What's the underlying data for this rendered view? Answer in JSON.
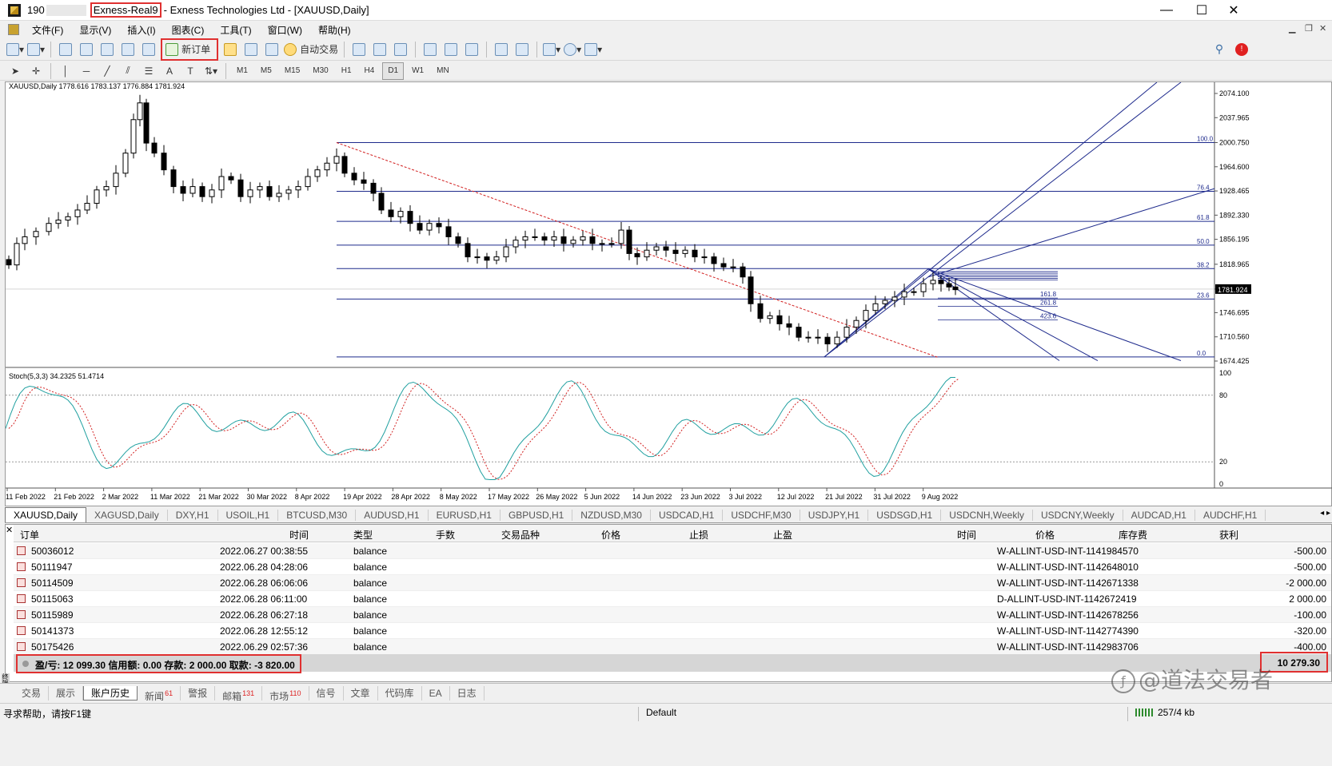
{
  "window": {
    "title_prefix": "190",
    "account": "Exness-Real9",
    "title_suffix": "- Exness Technologies Ltd - [XAUUSD,Daily]",
    "controls": [
      "—",
      "☐",
      "✕"
    ]
  },
  "menu": {
    "items": [
      "文件(F)",
      "显示(V)",
      "插入(I)",
      "图表(C)",
      "工具(T)",
      "窗口(W)",
      "帮助(H)"
    ]
  },
  "toolbar": {
    "new_order": "新订单",
    "auto_trade": "自动交易"
  },
  "timeframes": [
    "M1",
    "M5",
    "M15",
    "M30",
    "H1",
    "H4",
    "D1",
    "W1",
    "MN"
  ],
  "chart": {
    "info": "XAUUSD,Daily  1778.616 1783.137 1776.884 1781.924",
    "stoch_info": "Stoch(5,3,3) 34.2325 51.4714",
    "price_labels": [
      "2074.100",
      "2037.965",
      "2000.750",
      "1964.600",
      "1928.465",
      "1892.330",
      "1856.195",
      "1818.965",
      "1781.924",
      "1746.695",
      "1710.560",
      "1674.425"
    ],
    "current_price": "1781.924",
    "fib_levels": [
      "100.0",
      "76.4",
      "61.8",
      "50.0",
      "38.2",
      "23.6",
      "0.0"
    ],
    "fib_ext_labels": [
      "161.8",
      "261.8",
      "423.6"
    ],
    "stoch_scale": [
      "100",
      "80",
      "20",
      "0"
    ],
    "date_labels": [
      "11 Feb 2022",
      "21 Feb 2022",
      "2 Mar 2022",
      "11 Mar 2022",
      "21 Mar 2022",
      "30 Mar 2022",
      "8 Apr 2022",
      "19 Apr 2022",
      "28 Apr 2022",
      "8 May 2022",
      "17 May 2022",
      "26 May 2022",
      "5 Jun 2022",
      "14 Jun 2022",
      "23 Jun 2022",
      "3 Jul 2022",
      "12 Jul 2022",
      "21 Jul 2022",
      "31 Jul 2022",
      "9 Aug 2022"
    ]
  },
  "chart_tabs": [
    "XAUUSD,Daily",
    "XAGUSD,Daily",
    "DXY,H1",
    "USOIL,H1",
    "BTCUSD,M30",
    "AUDUSD,H1",
    "EURUSD,H1",
    "GBPUSD,H1",
    "NZDUSD,M30",
    "USDCAD,H1",
    "USDCHF,M30",
    "USDJPY,H1",
    "USDSGD,H1",
    "USDCNH,Weekly",
    "USDCNY,Weekly",
    "AUDCAD,H1",
    "AUDCHF,H1"
  ],
  "history": {
    "columns": [
      "订单",
      "时间",
      "类型",
      "手数",
      "交易品种",
      "价格",
      "止损",
      "止盈",
      "时间",
      "价格",
      "库存费",
      "获利"
    ],
    "rows": [
      {
        "order": "50036012",
        "time": "2022.06.27 00:38:55",
        "type": "balance",
        "comment": "W-ALLINT-USD-INT-1141984570",
        "profit": "-500.00"
      },
      {
        "order": "50111947",
        "time": "2022.06.28 04:28:06",
        "type": "balance",
        "comment": "W-ALLINT-USD-INT-1142648010",
        "profit": "-500.00"
      },
      {
        "order": "50114509",
        "time": "2022.06.28 06:06:06",
        "type": "balance",
        "comment": "W-ALLINT-USD-INT-1142671338",
        "profit": "-2 000.00"
      },
      {
        "order": "50115063",
        "time": "2022.06.28 06:11:00",
        "type": "balance",
        "comment": "D-ALLINT-USD-INT-1142672419",
        "profit": "2 000.00"
      },
      {
        "order": "50115989",
        "time": "2022.06.28 06:27:18",
        "type": "balance",
        "comment": "W-ALLINT-USD-INT-1142678256",
        "profit": "-100.00"
      },
      {
        "order": "50141373",
        "time": "2022.06.28 12:55:12",
        "type": "balance",
        "comment": "W-ALLINT-USD-INT-1142774390",
        "profit": "-320.00"
      },
      {
        "order": "50175426",
        "time": "2022.06.29 02:57:36",
        "type": "balance",
        "comment": "W-ALLINT-USD-INT-1142983706",
        "profit": "-400.00"
      }
    ],
    "summary": "盈/亏: 12 099.30  信用额: 0.00  存款: 2 000.00  取款: -3 820.00",
    "total": "10 279.30"
  },
  "terminal_tabs": [
    {
      "label": "交易",
      "count": ""
    },
    {
      "label": "展示",
      "count": ""
    },
    {
      "label": "账户历史",
      "count": ""
    },
    {
      "label": "新闻",
      "count": "61"
    },
    {
      "label": "警报",
      "count": ""
    },
    {
      "label": "邮箱",
      "count": "131"
    },
    {
      "label": "市场",
      "count": "110"
    },
    {
      "label": "信号",
      "count": ""
    },
    {
      "label": "文章",
      "count": ""
    },
    {
      "label": "代码库",
      "count": ""
    },
    {
      "label": "EA",
      "count": ""
    },
    {
      "label": "日志",
      "count": ""
    }
  ],
  "side_label": "终端",
  "status": {
    "help": "寻求帮助，请按F1键",
    "profile": "Default",
    "traffic": "257/4 kb"
  },
  "watermark": "@道法交易者",
  "colors": {
    "candle": "#000000",
    "fib": "#1e2a8c",
    "trendline": "#d22020",
    "stoch_main": "#20a0a0",
    "stoch_signal": "#d22020",
    "highlight": "#e03030",
    "price_label_bg": "#000000"
  }
}
